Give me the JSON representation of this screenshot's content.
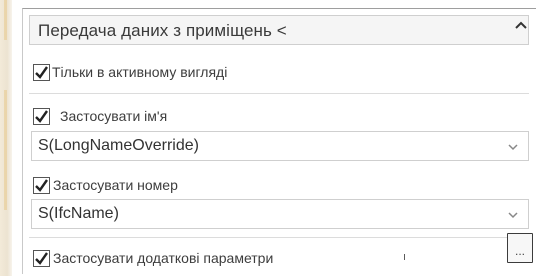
{
  "panel": {
    "title": "Передача даних з приміщень <",
    "collapse_icon": "chevron-up-icon"
  },
  "options": {
    "active_view_only": {
      "label": "Тільки в активному вигляді",
      "checked": true
    },
    "apply_name": {
      "label": "Застосувати ім'я",
      "checked": true
    },
    "name_select": {
      "value": "S(LongNameOverride)"
    },
    "apply_number": {
      "label": "Застосувати номер",
      "checked": true
    },
    "number_select": {
      "value": "S(IfcName)"
    },
    "apply_extra_params": {
      "label": "Застосувати додаткові параметри",
      "checked": true,
      "marker": "ı"
    },
    "extra_params_button": {
      "label": "..."
    }
  },
  "colors": {
    "border": "#cfcfcf",
    "header_bg": "#f5f5f5",
    "check": "#222222"
  }
}
